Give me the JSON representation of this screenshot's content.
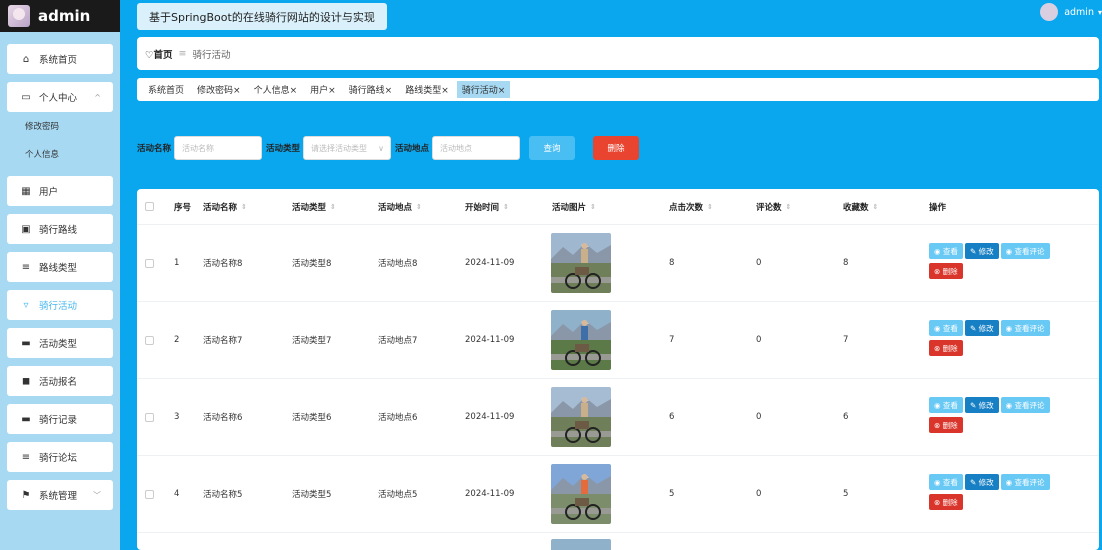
{
  "brand": {
    "title": "admin"
  },
  "header": {
    "title": "基于SpringBoot的在线骑行网站的设计与实现",
    "user": "admin"
  },
  "sidebar": {
    "items": [
      {
        "label": "系统首页",
        "icon": "home-icon",
        "glyph": "⌂"
      },
      {
        "label": "个人中心",
        "icon": "profile-icon",
        "glyph": "▭",
        "arrow": "^"
      },
      {
        "label": "用户",
        "icon": "grid-icon",
        "glyph": "▦"
      },
      {
        "label": "骑行路线",
        "icon": "route-icon",
        "glyph": "▣"
      },
      {
        "label": "路线类型",
        "icon": "list-icon",
        "glyph": "≡"
      },
      {
        "label": "骑行活动",
        "icon": "activity-icon",
        "glyph": "▿"
      },
      {
        "label": "活动类型",
        "icon": "monitor-icon",
        "glyph": "▬"
      },
      {
        "label": "活动报名",
        "icon": "signup-icon",
        "glyph": "◼"
      },
      {
        "label": "骑行记录",
        "icon": "record-icon",
        "glyph": "▬"
      },
      {
        "label": "骑行论坛",
        "icon": "forum-icon",
        "glyph": "≡"
      },
      {
        "label": "系统管理",
        "icon": "flag-icon",
        "glyph": "⚑",
        "arrow": "﹀"
      }
    ],
    "sub": [
      "修改密码",
      "个人信息"
    ]
  },
  "breadcrumb": {
    "home": "首页",
    "sep": "≡",
    "current": "骑行活动"
  },
  "tabs": [
    "系统首页",
    "修改密码×",
    "个人信息×",
    "用户×",
    "骑行路线×",
    "路线类型×",
    "骑行活动×"
  ],
  "search": {
    "name_label": "活动名称",
    "name_placeholder": "活动名称",
    "type_label": "活动类型",
    "type_placeholder": "请选择活动类型",
    "place_label": "活动地点",
    "place_placeholder": "活动地点",
    "query_btn": "查询",
    "delete_btn": "删除"
  },
  "table": {
    "headers": {
      "index": "序号",
      "name": "活动名称",
      "type": "活动类型",
      "place": "活动地点",
      "start": "开始时间",
      "image": "活动图片",
      "clicks": "点击次数",
      "comments": "评论数",
      "favs": "收藏数",
      "ops": "操作"
    },
    "sort_glyph": "⇕",
    "rows": [
      {
        "index": "1",
        "name": "活动名称8",
        "type": "活动类型8",
        "place": "活动地点8",
        "start": "2024-11-09",
        "clicks": "8",
        "comments": "0",
        "favs": "8"
      },
      {
        "index": "2",
        "name": "活动名称7",
        "type": "活动类型7",
        "place": "活动地点7",
        "start": "2024-11-09",
        "clicks": "7",
        "comments": "0",
        "favs": "7"
      },
      {
        "index": "3",
        "name": "活动名称6",
        "type": "活动类型6",
        "place": "活动地点6",
        "start": "2024-11-09",
        "clicks": "6",
        "comments": "0",
        "favs": "6"
      },
      {
        "index": "4",
        "name": "活动名称5",
        "type": "活动类型5",
        "place": "活动地点5",
        "start": "2024-11-09",
        "clicks": "5",
        "comments": "0",
        "favs": "5"
      }
    ],
    "ops": {
      "view": "◉ 查看",
      "edit": "✎ 修改",
      "comments": "◉ 查看评论",
      "delete": "⊗ 删除"
    }
  },
  "colors": {
    "accent": "#0aa7ee",
    "sidebar": "#a7d9f3",
    "danger": "#e8442f",
    "primary": "#1780c5"
  }
}
